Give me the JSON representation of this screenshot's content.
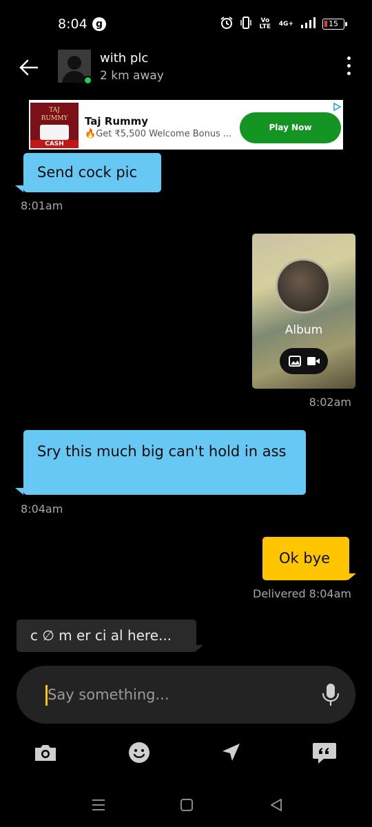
{
  "status_bar": {
    "time": "8:04",
    "g_badge": "g",
    "network_label": "Vo LTE",
    "network_gen": "4G+",
    "battery_level": "15"
  },
  "header": {
    "contact_name": "with plc",
    "distance": "2 km away",
    "online": true
  },
  "ad": {
    "logo_line1": "TAJ",
    "logo_line2": "RUMMY",
    "logo_badge": "CASH",
    "title": "Taj Rummy",
    "description": "Get ₹5,500 Welcome Bonus ...",
    "cta": "Play Now"
  },
  "messages": [
    {
      "direction": "in",
      "text": "Send cock pic",
      "time": "8:01am"
    },
    {
      "direction": "out",
      "type": "album",
      "album_label": "Album",
      "time": "8:02am"
    },
    {
      "direction": "in",
      "text": "Sry this much big can't hold in ass",
      "time": "8:04am"
    },
    {
      "direction": "out",
      "text": "Ok bye",
      "time": "Delivered 8:04am"
    }
  ],
  "typing_chip": "c ∅ m er ci al  here...",
  "composer": {
    "placeholder": "Say something...",
    "value": ""
  },
  "toolbar": {
    "icons": [
      "camera-icon",
      "smiley-icon",
      "send-location-icon",
      "quote-icon"
    ]
  },
  "colors": {
    "background": "#000000",
    "incoming_bubble": "#68c8f4",
    "outgoing_bubble": "#ffc500",
    "online_dot": "#1dd05a",
    "ad_cta": "#149422"
  }
}
